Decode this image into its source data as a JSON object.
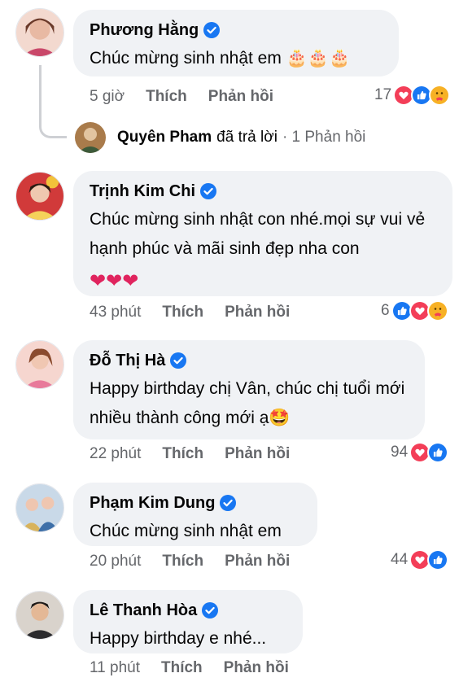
{
  "action_labels": {
    "like": "Thích",
    "reply": "Phản hồi"
  },
  "comments": [
    {
      "author": "Phương Hằng",
      "verified": true,
      "text": "Chúc mừng sinh nhật em 🎂🎂🎂",
      "time": "5 giờ",
      "reaction_count": "17",
      "reactions": [
        "love",
        "like",
        "care"
      ]
    },
    {
      "author": "Trịnh Kim Chi",
      "verified": true,
      "text": "Chúc mừng sinh nhật con nhé.mọi sự vui vẻ hạnh phúc và mãi sinh đẹp nha con",
      "emojis": "❤❤❤",
      "time": "43 phút",
      "reaction_count": "6",
      "reactions": [
        "like",
        "love",
        "care"
      ]
    },
    {
      "author": "Đỗ Thị Hà",
      "verified": true,
      "text": "Happy birthday chị Vân, chúc chị tuổi mới nhiều thành công mới ạ🤩",
      "time": "22 phút",
      "reaction_count": "94",
      "reactions": [
        "love",
        "like"
      ]
    },
    {
      "author": "Phạm Kim Dung",
      "verified": true,
      "text": "Chúc mừng sinh nhật em",
      "time": "20 phút",
      "reaction_count": "44",
      "reactions": [
        "love",
        "like"
      ]
    },
    {
      "author": "Lê Thanh Hòa",
      "verified": true,
      "text": "Happy birthday e nhé...",
      "time": "11 phút",
      "reaction_count": "",
      "reactions": []
    }
  ],
  "reply_thread": {
    "author": "Quyên Pham",
    "verb": "đã trả lời",
    "summary": "· 1 Phản hồi"
  },
  "colors": {
    "bubble": "#f0f2f5",
    "meta_text": "#65676b",
    "verified": "#1877f2",
    "like": "#1877f2",
    "love": "#f33e58",
    "care": "#f7b125"
  }
}
